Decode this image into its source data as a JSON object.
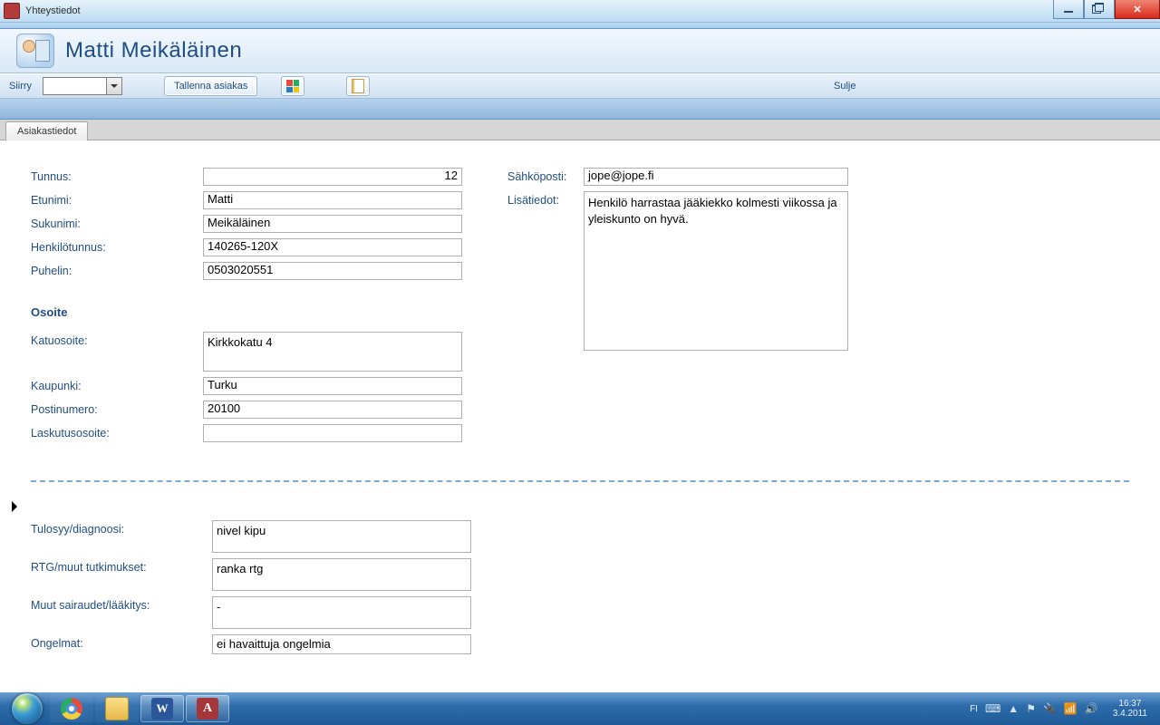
{
  "window": {
    "title": "Yhteystiedot"
  },
  "header": {
    "person_name": "Matti Meikäläinen"
  },
  "toolbar": {
    "goto_label": "Siirry",
    "save_label": "Tallenna asiakas",
    "close_label": "Sulje"
  },
  "tabs": {
    "main": "Asiakastiedot"
  },
  "labels": {
    "tunnus": "Tunnus:",
    "etunimi": "Etunimi:",
    "sukunimi": "Sukunimi:",
    "henkilotunnus": "Henkilötunnus:",
    "puhelin": "Puhelin:",
    "osoite_section": "Osoite",
    "katuosoite": "Katuosoite:",
    "kaupunki": "Kaupunki:",
    "postinumero": "Postinumero:",
    "laskutusosoite": "Laskutusosoite:",
    "sahkoposti": "Sähköposti:",
    "lisatiedot": "Lisätiedot:",
    "tulosyy": "Tulosyy/diagnoosi:",
    "rtg": "RTG/muut tutkimukset:",
    "muut": "Muut sairaudet/lääkitys:",
    "ongelmat": "Ongelmat:"
  },
  "values": {
    "tunnus": "12",
    "etunimi": "Matti",
    "sukunimi": "Meikäläinen",
    "henkilotunnus": "140265-120X",
    "puhelin": "0503020551",
    "katuosoite": "Kirkkokatu 4",
    "kaupunki": "Turku",
    "postinumero": "20100",
    "laskutusosoite": "",
    "sahkoposti": "jope@jope.fi",
    "lisatiedot": "Henkilö harrastaa jääkiekko kolmesti viikossa ja yleiskunto on hyvä.",
    "tulosyy": "nivel kipu",
    "rtg": "ranka rtg",
    "muut": "-",
    "ongelmat": "ei havaittuja ongelmia"
  },
  "taskbar": {
    "lang": "FI",
    "time": "16:37",
    "date": "3.4.2011",
    "word_glyph": "W",
    "access_glyph": "A"
  }
}
